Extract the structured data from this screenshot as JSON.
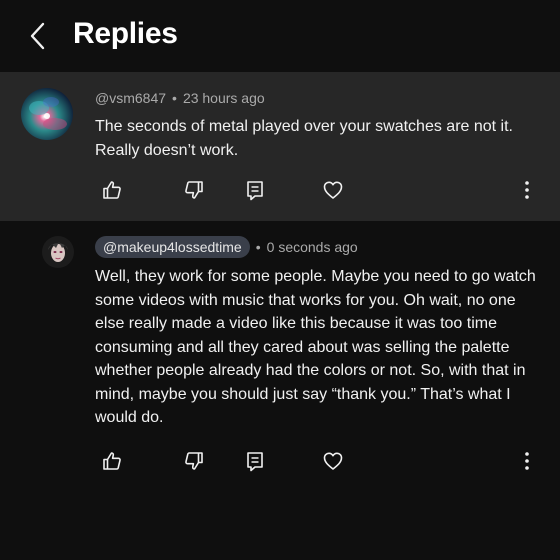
{
  "header": {
    "title": "Replies"
  },
  "parent_comment": {
    "handle": "@vsm6847",
    "separator": "•",
    "time": "23 hours ago",
    "text": "The seconds of metal played over your swatches are not it. Really doesn’t work."
  },
  "reply_comment": {
    "handle": "@makeup4lossedtime",
    "separator": "•",
    "time": "0 seconds ago",
    "text": "Well, they work for some people. Maybe you need to go watch some videos with music that works for you. Oh wait, no one else really made a video like this because it was too time consuming and all they cared about was selling the palette whether people already had the colors or not. So, with that in mind, maybe you should just say “thank you.” That’s what I would do."
  },
  "icons": {
    "back": "chevron-left-icon",
    "like": "thumbs-up-icon",
    "dislike": "thumbs-down-icon",
    "reply": "reply-icon",
    "heart": "heart-icon",
    "more": "more-vertical-icon"
  },
  "colors": {
    "background": "#0f0f0f",
    "parent_background": "#272727",
    "meta_text": "#aaaaaa",
    "chip": "#3a3f4a"
  }
}
